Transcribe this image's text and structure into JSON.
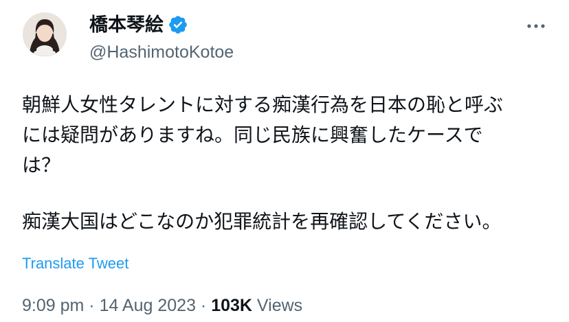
{
  "author": {
    "display_name": "橋本琴絵",
    "handle": "@HashimotoKotoe",
    "verified": true,
    "verified_icon": "verified-badge-icon",
    "verified_color": "#1d9bf0"
  },
  "menu": {
    "more_icon": "more-horizontal-icon"
  },
  "tweet": {
    "lines": [
      "朝鮮人女性タレントに対する痴漢行為を日本の恥と呼ぶ",
      "には疑問がありますね。同じ民族に興奮したケースで",
      "は？",
      "痴漢大国はどこなのか犯罪統計を再確認してください。"
    ],
    "translate_label": "Translate Tweet"
  },
  "meta": {
    "time": "9:09 pm",
    "separator": " · ",
    "date": "14 Aug 2023",
    "views_count": "103K",
    "views_label": "Views"
  },
  "colors": {
    "text": "#0f1419",
    "secondary": "#536471",
    "link": "#1d9bf0",
    "background": "#ffffff"
  }
}
